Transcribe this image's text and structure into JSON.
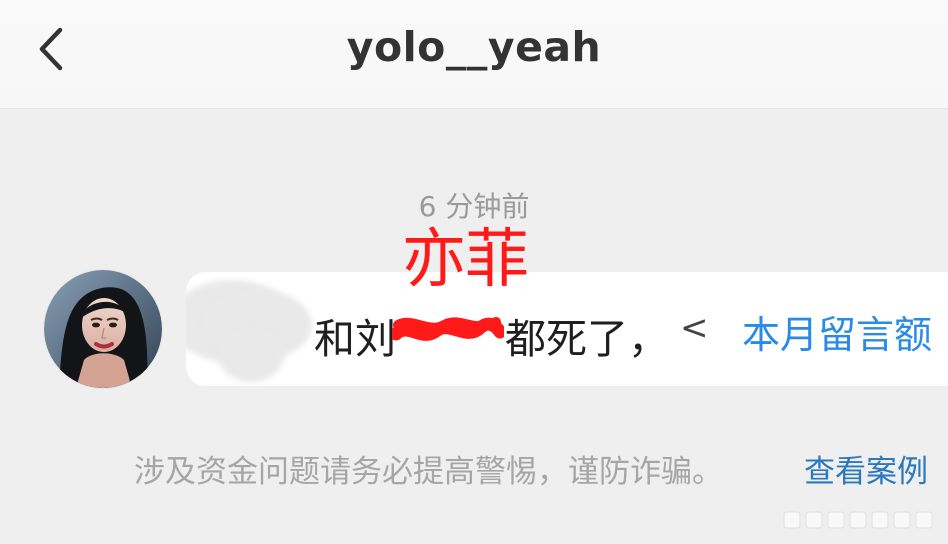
{
  "header": {
    "title": "yolo__yeah"
  },
  "chat": {
    "timestamp": "6 分钟前",
    "message": {
      "fragment_1": "和刘",
      "fragment_2": "都死了，",
      "truncated_glyph": "<",
      "quota_text": "本月留言额"
    },
    "overlay_label": "亦菲",
    "warning_text": "涉及资金问题请务必提高警惕，谨防诈骗。",
    "warning_link": "查看案例"
  },
  "colors": {
    "link_blue": "#2a8be6",
    "warning_link_blue": "#2b78bd",
    "overlay_red": "#ff1a1a"
  },
  "icons": {
    "back": "chevron-left-icon"
  }
}
